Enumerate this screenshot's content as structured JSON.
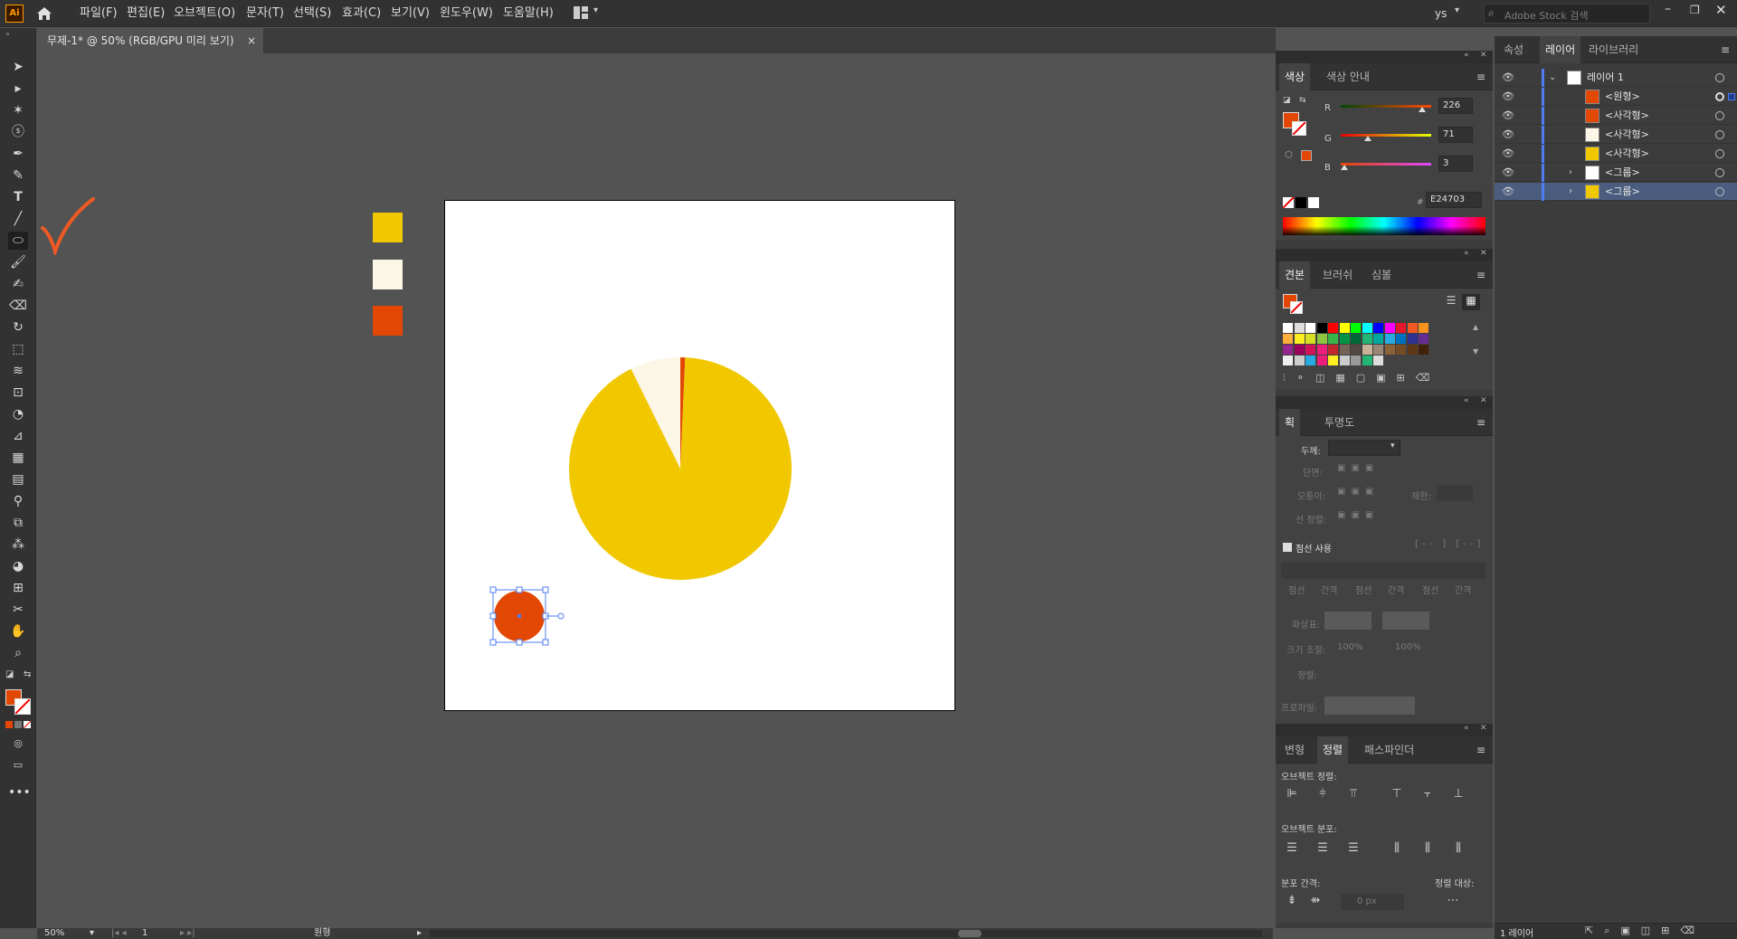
{
  "menubar": {
    "items": [
      "파일(F)",
      "편집(E)",
      "오브젝트(O)",
      "문자(T)",
      "선택(S)",
      "효과(C)",
      "보기(V)",
      "윈도우(W)",
      "도움말(H)"
    ],
    "app_logo": "Ai",
    "user": "ys",
    "search_placeholder": "Adobe Stock 검색"
  },
  "document_tab": {
    "title": "무제-1* @ 50% (RGB/GPU 미리 보기)",
    "close": "×"
  },
  "colors": {
    "accent_fill": "#e24703",
    "yellow": "#f1c800",
    "cream": "#fcf6e6",
    "artboard": "#ffffff"
  },
  "color_panel": {
    "tabs": [
      "색상",
      "색상 안내"
    ],
    "r_label": "R",
    "g_label": "G",
    "b_label": "B",
    "r": "226",
    "g": "71",
    "b": "3",
    "hex": "E24703"
  },
  "swatch_panel": {
    "tabs": [
      "견본",
      "브러쉬",
      "심볼"
    ]
  },
  "stroke_panel": {
    "tabs": [
      "획",
      "투명도"
    ],
    "weight_label": "두께:",
    "cap_label": "단면:",
    "corner_label": "모퉁이:",
    "limit_label": "제한:",
    "align_label": "선 정렬:",
    "dashed_label": "점선 사용",
    "dash_labels": [
      "점선",
      "간격",
      "점선",
      "간격",
      "점선",
      "간격"
    ],
    "arrow_label": "화살표:",
    "scale_label": "크기 조절:",
    "scale_value": "100%",
    "align2_label": "정렬:",
    "profile_label": "프로파일:"
  },
  "align_panel": {
    "tabs": [
      "변형",
      "정렬",
      "패스파인더"
    ],
    "object_align_label": "오브젝트 정렬:",
    "object_distribute_label": "오브젝트 분포:",
    "distribute_spacing_label": "분포 간격:",
    "align_to_label": "정렬 대상:",
    "spacing_value": "0 px"
  },
  "layers_panel": {
    "tabs": [
      "속성",
      "레이어",
      "라이브러리"
    ],
    "rows": [
      {
        "name": "레이어 1",
        "thumb": "#fff"
      },
      {
        "name": "<원형>",
        "thumb": "#e24703"
      },
      {
        "name": "<사각형>",
        "thumb": "#e24703"
      },
      {
        "name": "<사각형>",
        "thumb": "#fcf6e6"
      },
      {
        "name": "<사각형>",
        "thumb": "#f1c800"
      },
      {
        "name": "<그룹>",
        "thumb": "#ffffff"
      },
      {
        "name": "<그룹>",
        "thumb": "#f1c800"
      }
    ],
    "footer": "1 레이어"
  },
  "statusbar": {
    "zoom": "50%",
    "page": "1",
    "tool": "원형"
  },
  "artwork": {
    "pie": {
      "yellow_pct": 92,
      "cream_pct": 7.3,
      "red_pct": 0.7
    }
  }
}
